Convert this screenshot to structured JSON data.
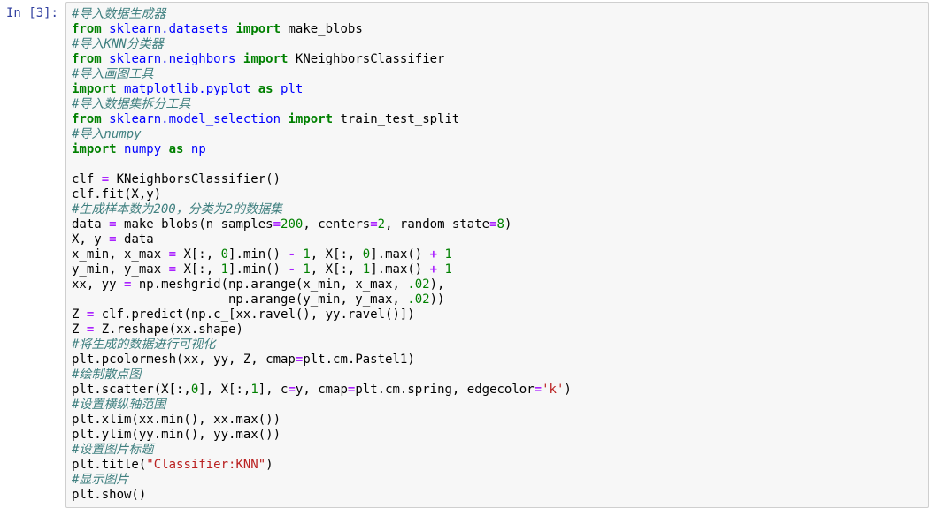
{
  "prompt": "In [3]:",
  "code": {
    "c1": "#导入数据生成器",
    "l2_from": "from",
    "l2_mod": "sklearn.datasets",
    "l2_import": "import",
    "l2_name": "make_blobs",
    "c3": "#导入KNN分类器",
    "l4_from": "from",
    "l4_mod": "sklearn.neighbors",
    "l4_import": "import",
    "l4_name": "KNeighborsClassifier",
    "c5": "#导入画图工具",
    "l6_import": "import",
    "l6_mod": "matplotlib.pyplot",
    "l6_as": "as",
    "l6_alias": "plt",
    "c7": "#导入数据集拆分工具",
    "l8_from": "from",
    "l8_mod": "sklearn.model_selection",
    "l8_import": "import",
    "l8_name": "train_test_split",
    "c9": "#导入numpy",
    "l10_import": "import",
    "l10_mod": "numpy",
    "l10_as": "as",
    "l10_alias": "np",
    "l12a": "clf ",
    "l12_eq": "=",
    "l12b": " KNeighborsClassifier()",
    "l13": "clf.fit(X,y)",
    "c14": "#生成样本数为200，分类为2的数据集",
    "l15a": "data ",
    "l15_eq": "=",
    "l15b": " make_blobs(n_samples",
    "l15_eq2": "=",
    "l15_n1": "200",
    "l15c": ", centers",
    "l15_eq3": "=",
    "l15_n2": "2",
    "l15d": ", random_state",
    "l15_eq4": "=",
    "l15_n3": "8",
    "l15e": ")",
    "l16a": "X, y ",
    "l16_eq": "=",
    "l16b": " data",
    "l17a": "x_min, x_max ",
    "l17_eq": "=",
    "l17b": " X[:, ",
    "l17_n1": "0",
    "l17c": "].min() ",
    "l17_op1": "-",
    "l17d": " ",
    "l17_n2": "1",
    "l17e": ", X[:, ",
    "l17_n3": "0",
    "l17f": "].max() ",
    "l17_op2": "+",
    "l17g": " ",
    "l17_n4": "1",
    "l18a": "y_min, y_max ",
    "l18_eq": "=",
    "l18b": " X[:, ",
    "l18_n1": "1",
    "l18c": "].min() ",
    "l18_op1": "-",
    "l18d": " ",
    "l18_n2": "1",
    "l18e": ", X[:, ",
    "l18_n3": "1",
    "l18f": "].max() ",
    "l18_op2": "+",
    "l18g": " ",
    "l18_n4": "1",
    "l19a": "xx, yy ",
    "l19_eq": "=",
    "l19b": " np.meshgrid(np.arange(x_min, x_max, ",
    "l19_n": ".02",
    "l19c": "),",
    "l20a": "                     np.arange(y_min, y_max, ",
    "l20_n": ".02",
    "l20b": "))",
    "l21a": "Z ",
    "l21_eq": "=",
    "l21b": " clf.predict(np.c_[xx.ravel(), yy.ravel()])",
    "l22a": "Z ",
    "l22_eq": "=",
    "l22b": " Z.reshape(xx.shape)",
    "c23": "#将生成的数据进行可视化",
    "l24a": "plt.pcolormesh(xx, yy, Z, cmap",
    "l24_eq": "=",
    "l24b": "plt.cm.Pastel1)",
    "c25": "#绘制散点图",
    "l26a": "plt.scatter(X[:,",
    "l26_n1": "0",
    "l26b": "], X[:,",
    "l26_n2": "1",
    "l26c": "], c",
    "l26_eq1": "=",
    "l26d": "y, cmap",
    "l26_eq2": "=",
    "l26e": "plt.cm.spring, edgecolor",
    "l26_eq3": "=",
    "l26_s": "'k'",
    "l26f": ")",
    "c27": "#设置横纵轴范围",
    "l28": "plt.xlim(xx.min(), xx.max())",
    "l29": "plt.ylim(yy.min(), yy.max())",
    "c30": "#设置图片标题",
    "l31a": "plt.title(",
    "l31_s": "\"Classifier:KNN\"",
    "l31b": ")",
    "c32": "#显示图片",
    "l33": "plt.show()"
  }
}
